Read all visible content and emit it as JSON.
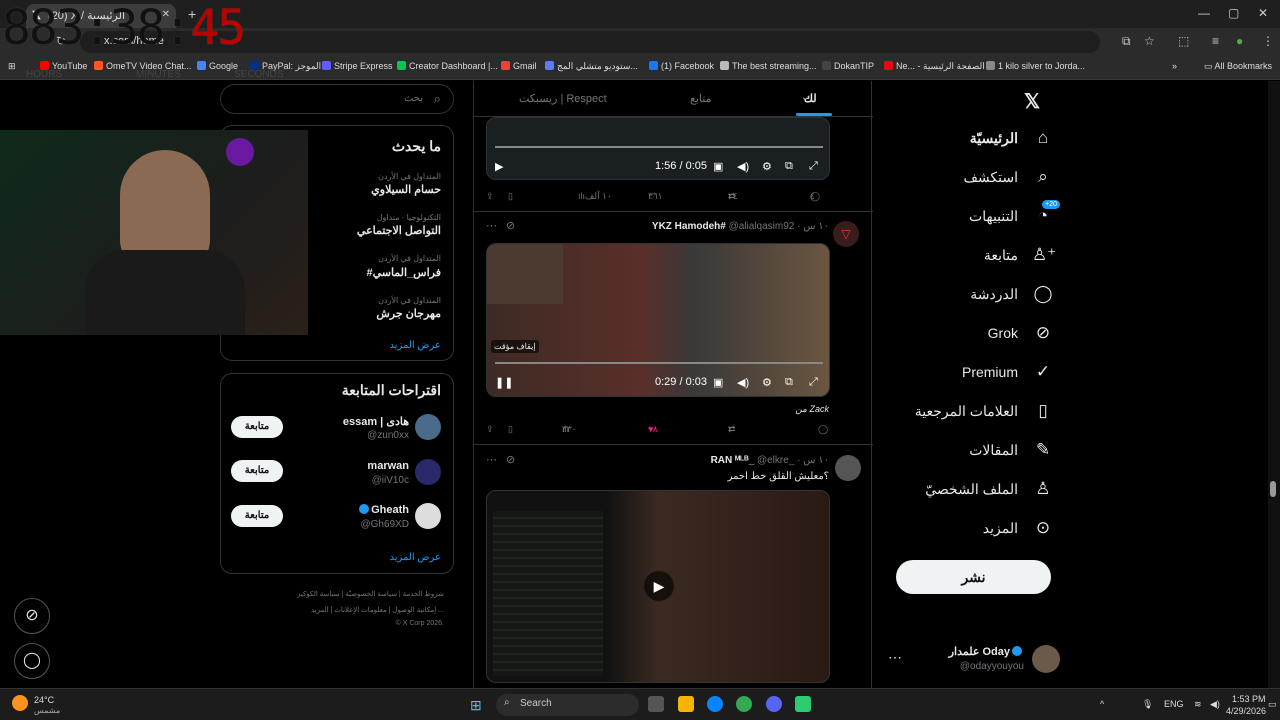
{
  "browser": {
    "tab_title": "(20) X / الرئيسية",
    "url": "x.com/home",
    "bookmarks": [
      {
        "label": "YouTube",
        "color": "#ff0000"
      },
      {
        "label": "OmeTV Video Chat...",
        "color": "#ff5722"
      },
      {
        "label": "Google",
        "color": "#4285f4"
      },
      {
        "label": "PayPal: الموجز",
        "color": "#003087"
      },
      {
        "label": "Stripe Express",
        "color": "#635bff"
      },
      {
        "label": "Creator Dashboard |...",
        "color": "#00c853"
      },
      {
        "label": "Gmail",
        "color": "#ea4335"
      },
      {
        "label": "ستوديو متشلي المج...",
        "color": "#5b7cfa"
      },
      {
        "label": "(1) Facebook",
        "color": "#1877f2"
      },
      {
        "label": "The best streaming...",
        "color": "#bbbbbb"
      },
      {
        "label": "DokanTIP",
        "color": "#444444"
      },
      {
        "label": "Ne... - الصفحة الرئيسية",
        "color": "#e50914"
      },
      {
        "label": "1 kilo silver to Jorda...",
        "color": "#888888"
      }
    ],
    "all_bookmarks": "All Bookmarks"
  },
  "overlay_clock": {
    "hours_minutes": "883:38:",
    "seconds": "45",
    "labels": [
      "HOURS",
      "MINUTES",
      "SECONDS"
    ]
  },
  "nav": {
    "items": [
      {
        "label": "الرئيسيّة",
        "icon": "home-icon",
        "glyph": "⌂"
      },
      {
        "label": "استكشف",
        "icon": "search-icon",
        "glyph": "⌕"
      },
      {
        "label": "التنبيهات",
        "icon": "bell-icon",
        "glyph": "🔔",
        "badge": "+20"
      },
      {
        "label": "متابعة",
        "icon": "follow-icon",
        "glyph": "⚇"
      },
      {
        "label": "الدردشة",
        "icon": "chat-icon",
        "glyph": "◯"
      },
      {
        "label": "Grok",
        "icon": "grok-icon",
        "glyph": "⊘"
      },
      {
        "label": "Premium",
        "icon": "premium-icon",
        "glyph": "✓"
      },
      {
        "label": "العلامات المرجعية",
        "icon": "bookmark-icon",
        "glyph": "▯"
      },
      {
        "label": "المقالات",
        "icon": "articles-icon",
        "glyph": "✎"
      },
      {
        "label": "الملف الشخصيّ",
        "icon": "profile-icon",
        "glyph": "♙"
      },
      {
        "label": "المزيد",
        "icon": "more-icon",
        "glyph": "⋯"
      }
    ],
    "post_button": "نشر",
    "account": {
      "name": "علمدار Oday",
      "handle": "@odayyouyou"
    }
  },
  "feed": {
    "tabs": [
      "لك",
      "متابع",
      "ريسبكت | Respect"
    ],
    "tweet1": {
      "time": "1:56 / 0:05",
      "replies": "٤",
      "retweets": "٢٤",
      "likes": "٣٦١",
      "views": "١٠ آلف"
    },
    "tweet2": {
      "author": "YKZ Hamodeh#",
      "handle": "@alialqasim92",
      "age": "١٠ س",
      "pause_label": "إيقاف مؤقت",
      "time": "0:29 / 0:03",
      "from": "من Zack",
      "replies": "",
      "retweets": "٢",
      "likes": "١٨",
      "views": "٣٣٠"
    },
    "tweet3": {
      "author": "RAN ᴹᴸᴮ_",
      "handle": "@elkre_",
      "age": "١٠ س",
      "text": "؟معليش القلق خط احمر"
    }
  },
  "sidebar": {
    "search_placeholder": "بحث",
    "trends_title": "ما يحدث",
    "trends": [
      {
        "meta": "المتداول في الأردن",
        "name": "حسام السيلاوي"
      },
      {
        "meta": "التكنولوجيا · متداول",
        "name": "التواصل الاجتماعي"
      },
      {
        "meta": "المتداول في الأردن",
        "name": "#فراس_الماسي"
      },
      {
        "meta": "المتداول في الأردن",
        "name": "مهرجان جرش"
      }
    ],
    "show_more": "عرض المزيد",
    "follow_title": "اقتراحات المتابعة",
    "suggestions": [
      {
        "name": "essam | هادى",
        "handle": "@zun0xx",
        "button": "متابعة"
      },
      {
        "name": "marwan",
        "handle": "@iiV10c",
        "button": "متابعة"
      },
      {
        "name": "Gheath",
        "handle": "@Gh69XD",
        "button": "متابعة"
      }
    ],
    "footer1": "شروط الخدمة | سياسة الخصوصيّة | سياسة الكوكيز",
    "footer2": "إمكانية الوصول | معلومات الإعلانات | المزيد ...",
    "footer3": "© X Corp 2026."
  },
  "taskbar": {
    "weather": "24°C",
    "weather_desc": "مشمس",
    "search": "Search",
    "lang": "ENG",
    "time": "1:53 PM",
    "date": "4/29/2026"
  }
}
